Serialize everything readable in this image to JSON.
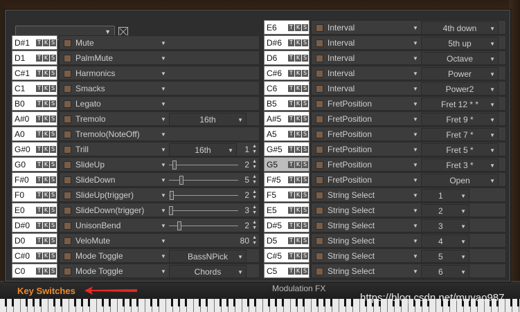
{
  "footer": {
    "key_switches": "Key Switches",
    "modulation_fx": "Modulation FX",
    "watermark": "https://blog.csdn.net/muyao987"
  },
  "tks": [
    "T",
    "K",
    "S"
  ],
  "left_rows": [
    {
      "key": "D#1",
      "label": "Mute"
    },
    {
      "key": "D1",
      "label": "PalmMute"
    },
    {
      "key": "C#1",
      "label": "Harmonics"
    },
    {
      "key": "C1",
      "label": "Smacks"
    },
    {
      "key": "B0",
      "label": "Legato"
    },
    {
      "key": "A#0",
      "label": "Tremolo",
      "value": "16th"
    },
    {
      "key": "A0",
      "label": "Tremolo(NoteOff)"
    },
    {
      "key": "G#0",
      "label": "Trill",
      "value": "16th",
      "number": "1"
    },
    {
      "key": "G0",
      "label": "SlideUp",
      "number": "2",
      "slider": 0.08
    },
    {
      "key": "F#0",
      "label": "SlideDown",
      "number": "5",
      "slider": 0.18
    },
    {
      "key": "F0",
      "label": "SlideUp(trigger)",
      "number": "2",
      "slider": 0.04
    },
    {
      "key": "E0",
      "label": "SlideDown(trigger)",
      "number": "3",
      "slider": 0.03
    },
    {
      "key": "D#0",
      "label": "UnisonBend",
      "number": "2",
      "slider": 0.15
    },
    {
      "key": "D0",
      "label": "VeloMute",
      "number": "80"
    },
    {
      "key": "C#0",
      "label": "Mode Toggle",
      "value": "BassNPick"
    },
    {
      "key": "C0",
      "label": "Mode Toggle",
      "value": "Chords"
    }
  ],
  "right_rows": [
    {
      "key": "E6",
      "label": "Interval",
      "value": "4th down"
    },
    {
      "key": "D#6",
      "label": "Interval",
      "value": "5th up"
    },
    {
      "key": "D6",
      "label": "Interval",
      "value": "Octave"
    },
    {
      "key": "C#6",
      "label": "Interval",
      "value": "Power"
    },
    {
      "key": "C6",
      "label": "Interval",
      "value": "Power2"
    },
    {
      "key": "B5",
      "label": "FretPosition",
      "value": "Fret 12  *  *"
    },
    {
      "key": "A#5",
      "label": "FretPosition",
      "value": "Fret 9    *"
    },
    {
      "key": "A5",
      "label": "FretPosition",
      "value": "Fret 7    *"
    },
    {
      "key": "G#5",
      "label": "FretPosition",
      "value": "Fret 5    *"
    },
    {
      "key": "G5",
      "label": "FretPosition",
      "value": "Fret 3    *"
    },
    {
      "key": "F#5",
      "label": "FretPosition",
      "value": "Open"
    },
    {
      "key": "F5",
      "label": "String Select",
      "value": "1"
    },
    {
      "key": "E5",
      "label": "String Select",
      "value": "2"
    },
    {
      "key": "D#5",
      "label": "String Select",
      "value": "3"
    },
    {
      "key": "D5",
      "label": "String Select",
      "value": "4"
    },
    {
      "key": "C#5",
      "label": "String Select",
      "value": "5"
    },
    {
      "key": "C5",
      "label": "String Select",
      "value": "6"
    }
  ]
}
